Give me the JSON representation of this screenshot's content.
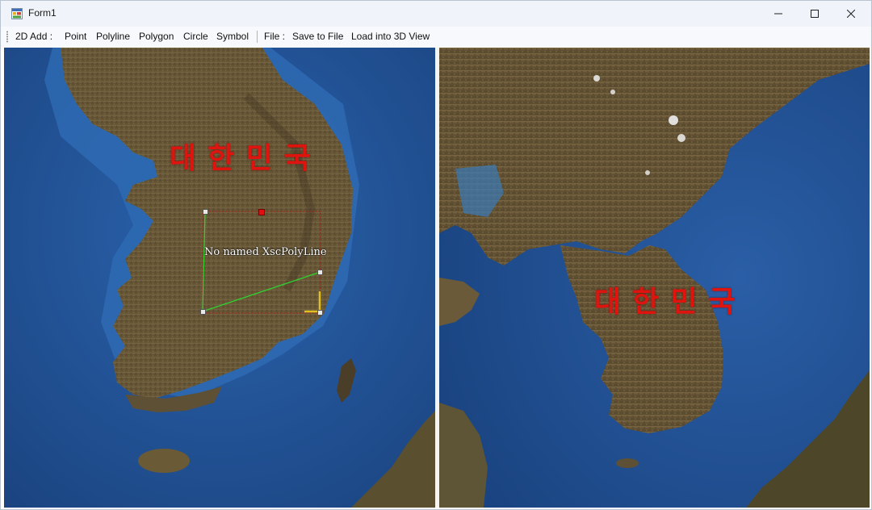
{
  "window": {
    "title": "Form1"
  },
  "toolbar": {
    "add_label": "2D Add :",
    "point": "Point",
    "polyline": "Polyline",
    "polygon": "Polygon",
    "circle": "Circle",
    "symbol": "Symbol",
    "file_label": "File :",
    "save": "Save to File",
    "load3d": "Load into 3D View"
  },
  "map_2d": {
    "country_label": "대한민국",
    "polyline_name": "No named XscPolyLine"
  },
  "map_3d": {
    "country_label": "대한민국"
  },
  "colors": {
    "label_red": "#e0140f",
    "polyline_green": "#2fd42f",
    "bbox_red": "#c01010",
    "axis_yellow": "#e0c020",
    "sea": "#23559a",
    "land": "#6b5a38"
  }
}
